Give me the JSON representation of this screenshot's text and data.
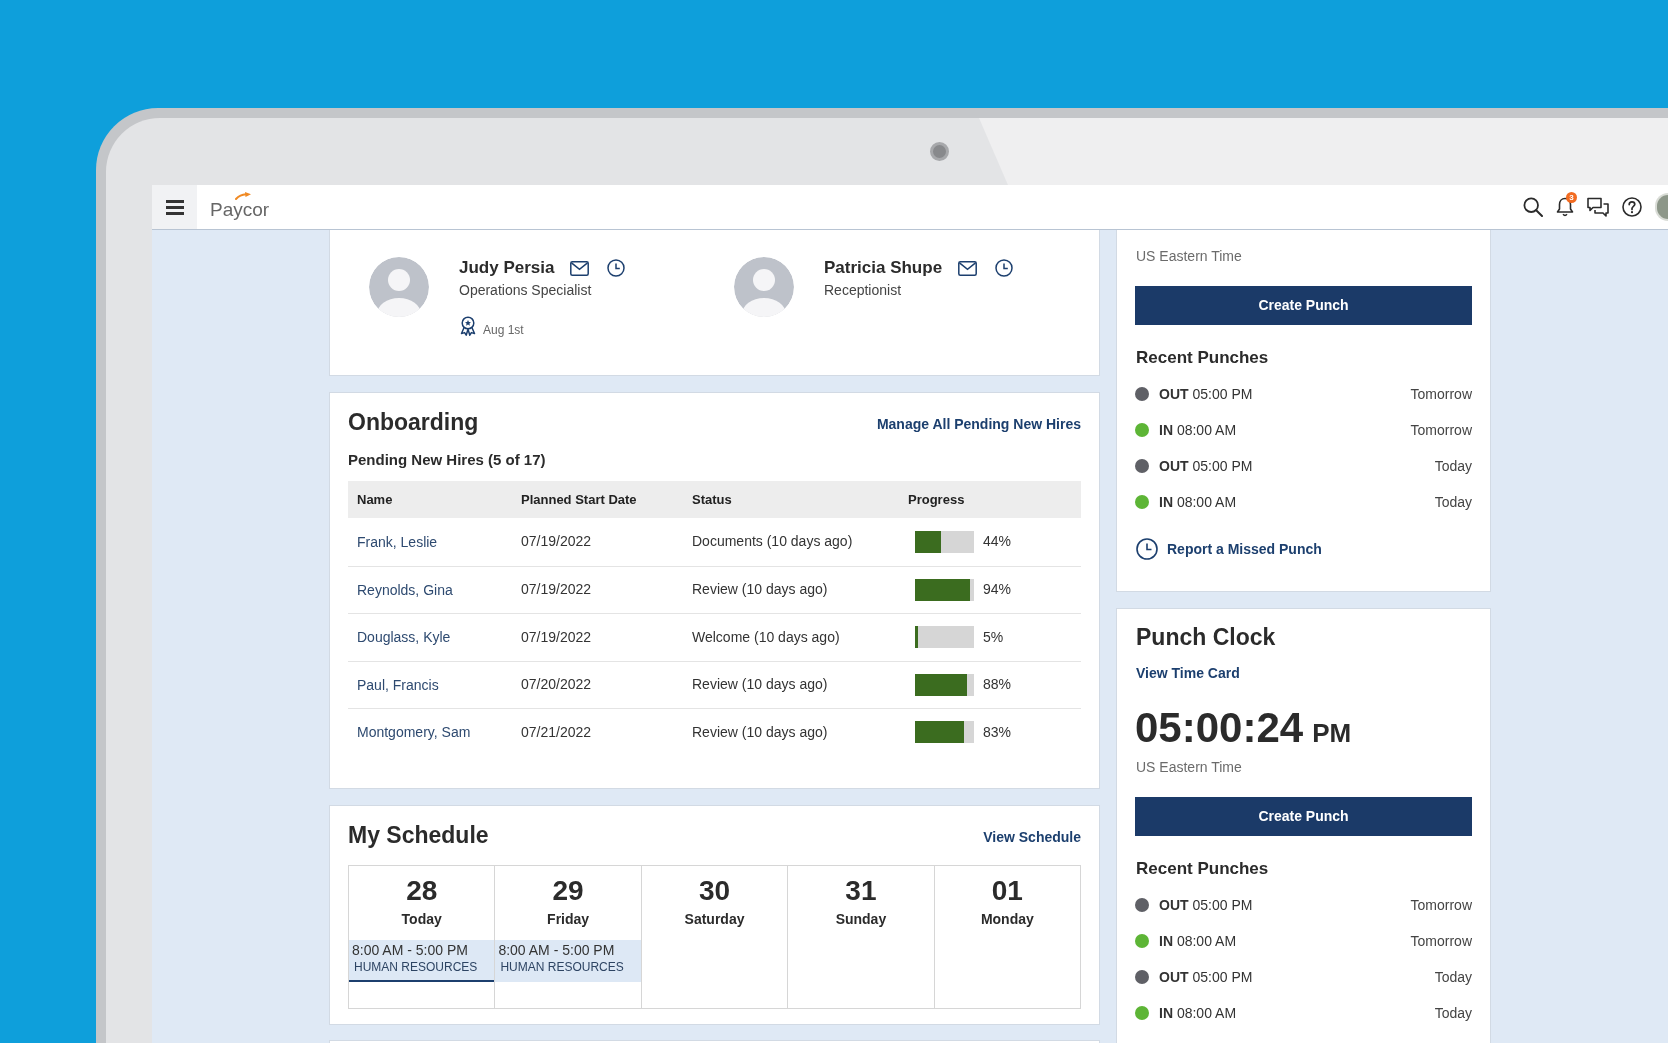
{
  "app_bar": {
    "logo": "Paycor",
    "notification_count": "3"
  },
  "people": [
    {
      "name": "Judy Persia",
      "title": "Operations Specialist",
      "anniversary": "Aug 1st"
    },
    {
      "name": "Patricia Shupe",
      "title": "Receptionist"
    }
  ],
  "onboarding": {
    "title": "Onboarding",
    "link": "Manage All Pending New Hires",
    "subtitle": "Pending New Hires (5 of 17)",
    "columns": [
      "Name",
      "Planned Start Date",
      "Status",
      "Progress"
    ],
    "rows": [
      {
        "name": "Frank, Leslie",
        "start_date": "07/19/2022",
        "status": "Documents (10 days ago)",
        "level": 0.44,
        "percent": "44%"
      },
      {
        "name": "Reynolds, Gina",
        "start_date": "07/19/2022",
        "status": "Review (10 days ago)",
        "level": 0.94,
        "percent": "94%"
      },
      {
        "name": "Douglass, Kyle",
        "start_date": "07/19/2022",
        "status": "Welcome (10 days ago)",
        "level": 0.05,
        "percent": "5%"
      },
      {
        "name": "Paul, Francis",
        "start_date": "07/20/2022",
        "status": "Review (10 days ago)",
        "level": 0.88,
        "percent": "88%"
      },
      {
        "name": "Montgomery, Sam",
        "start_date": "07/21/2022",
        "status": "Review (10 days ago)",
        "level": 0.83,
        "percent": "83%"
      }
    ]
  },
  "schedule": {
    "title": "My Schedule",
    "link": "View Schedule",
    "days": [
      {
        "date": "28",
        "day": "Today",
        "selected": true,
        "shift": {
          "time": "8:00 AM - 5:00 PM",
          "department": "HUMAN RESOURCES"
        }
      },
      {
        "date": "29",
        "day": "Friday",
        "selected": false,
        "shift": {
          "time": "8:00 AM - 5:00 PM",
          "department": "HUMAN RESOURCES"
        }
      },
      {
        "date": "30",
        "day": "Saturday",
        "selected": false
      },
      {
        "date": "31",
        "day": "Sunday",
        "selected": false
      },
      {
        "date": "01",
        "day": "Monday",
        "selected": false
      }
    ]
  },
  "time_punches": {
    "timezone": "US Eastern Time",
    "button": "Create Punch",
    "recent_title": "Recent Punches",
    "punches": [
      {
        "label": "**OUT** 05:00 PM",
        "when": "Tomorrow",
        "color": "#5f6066"
      },
      {
        "label": "**IN** 08:00 AM",
        "when": "Tomorrow",
        "color": "#5db536"
      },
      {
        "label": "**OUT** 05:00 PM",
        "when": "Today",
        "color": "#5f6066"
      },
      {
        "label": "**IN** 08:00 AM",
        "when": "Today",
        "color": "#5db536"
      }
    ],
    "missed_punch_link": "Report a Missed Punch"
  },
  "punch_clock": {
    "title": "Punch Clock",
    "link": "View Time Card",
    "time": "05:00:24",
    "meridiem": "PM",
    "timezone": "US Eastern Time",
    "button": "Create Punch",
    "recent_title": "Recent Punches",
    "punches": [
      {
        "label": "**OUT** 05:00 PM",
        "when": "Tomorrow",
        "color": "#5f6066"
      },
      {
        "label": "**IN** 08:00 AM",
        "when": "Tomorrow",
        "color": "#5db536"
      },
      {
        "label": "**OUT** 05:00 PM",
        "when": "Today",
        "color": "#5f6066"
      },
      {
        "label": "**IN** 08:00 AM",
        "when": "Today",
        "color": "#5db536"
      }
    ]
  }
}
